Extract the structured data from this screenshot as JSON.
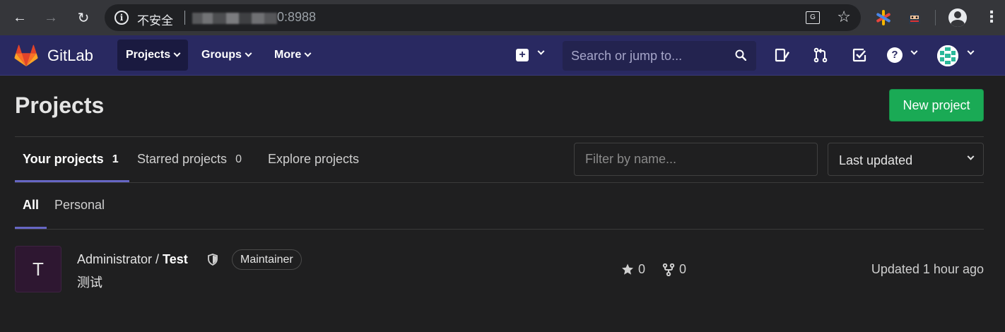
{
  "browser": {
    "insecure_label": "不安全",
    "url_visible": "0:8988"
  },
  "navbar": {
    "brand": "GitLab",
    "items": [
      {
        "label": "Projects"
      },
      {
        "label": "Groups"
      },
      {
        "label": "More"
      }
    ],
    "search_placeholder": "Search or jump to...",
    "help_label": "?"
  },
  "page": {
    "title": "Projects",
    "new_project_label": "New project"
  },
  "tabs": [
    {
      "label": "Your projects",
      "count": "1"
    },
    {
      "label": "Starred projects",
      "count": "0"
    },
    {
      "label": "Explore projects"
    }
  ],
  "filter": {
    "placeholder": "Filter by name..."
  },
  "sort": {
    "selected": "Last updated"
  },
  "subtabs": [
    {
      "label": "All"
    },
    {
      "label": "Personal"
    }
  ],
  "project": {
    "avatar_letter": "T",
    "namespace": "Administrator / ",
    "name": "Test",
    "role": "Maintainer",
    "description": "测试",
    "stars": "0",
    "forks": "0",
    "updated": "Updated 1 hour ago"
  },
  "colors": {
    "navbar": "#292961",
    "accent": "#6666c4",
    "new_project": "#1aaa55",
    "background": "#1f1f20"
  }
}
